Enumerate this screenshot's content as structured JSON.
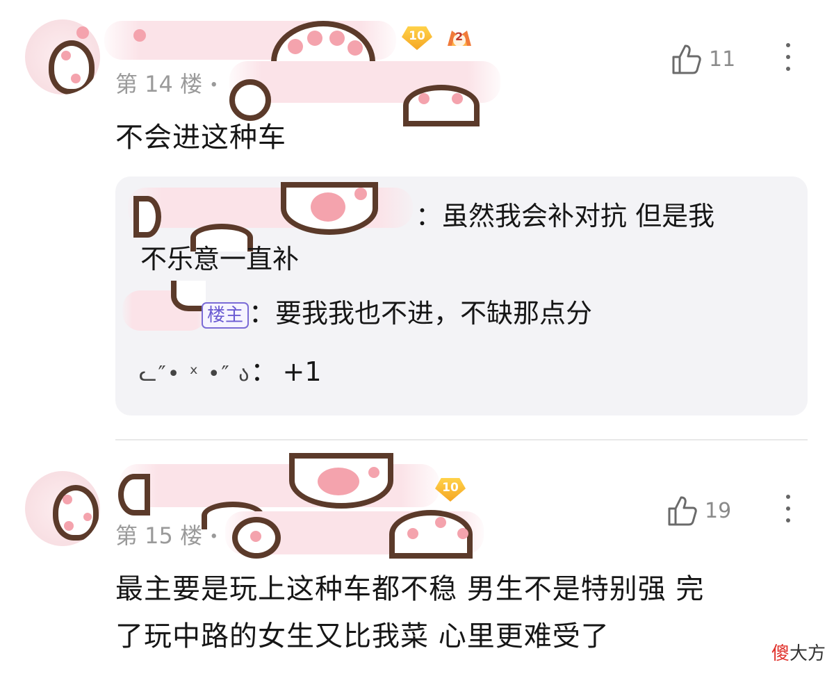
{
  "comments": [
    {
      "floor": "第 14 楼",
      "dot": "•",
      "like_count": "11",
      "level_badge": "10",
      "game_badge": "2",
      "text": "不会进这种车",
      "replies": [
        {
          "name_suffix": "：",
          "text": "虽然我会补对抗 但是我",
          "text_cont": "不乐意一直补"
        },
        {
          "op_tag": "楼主",
          "sep": "：",
          "text": "要我我也不进，不缺那点分"
        },
        {
          "name": "ᓚ″• ˣ •″ ა",
          "sep": "：",
          "text": "+1"
        }
      ]
    },
    {
      "floor": "第 15 楼",
      "dot": "•",
      "like_count": "19",
      "level_badge": "10",
      "text_line1": "最主要是玩上这种车都不稳 男生不是特别强 完",
      "text_line2": "了玩中路的女生又比我菜 心里更难受了"
    }
  ],
  "icons": {
    "like": "thumbs-up-icon",
    "more": "more-vertical-icon",
    "level": "level-badge-icon",
    "game": "game-rank-badge-icon"
  },
  "colors": {
    "op_tag": "#6b5bd2",
    "level_badge": "#f5a623",
    "reply_bg": "#f3f3f6",
    "sticker_pink": "#f4a3ad",
    "sticker_brown": "#5b3a2a"
  },
  "watermark": {
    "accent": "傻",
    "rest": "大方"
  }
}
